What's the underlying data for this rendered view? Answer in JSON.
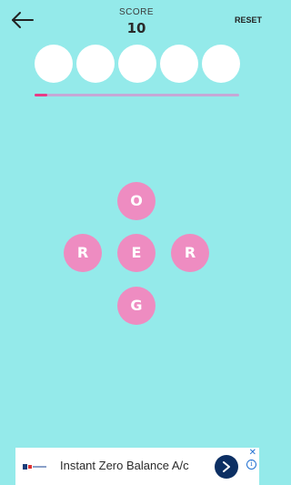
{
  "header": {
    "score_label": "SCORE",
    "score_value": "10",
    "reset_label": "RESET",
    "back_icon": "arrow-left-icon"
  },
  "answer_slots": {
    "count": 5,
    "filled": [
      "",
      "",
      "",
      "",
      ""
    ]
  },
  "progress": {
    "fraction": 0.06
  },
  "letters": [
    "O",
    "R",
    "E",
    "R",
    "G"
  ],
  "ad": {
    "headline": "Instant Zero Balance A/c",
    "close_glyph": "✕",
    "info_glyph": "i",
    "go_icon": "chevron-right-icon"
  },
  "colors": {
    "background": "#94eaea",
    "slot": "#ffffff",
    "letter_tile": "#ee8cc1",
    "progress_fill": "#e83c86",
    "progress_track": "#c6a8d6",
    "ad_button": "#0c2f63"
  }
}
